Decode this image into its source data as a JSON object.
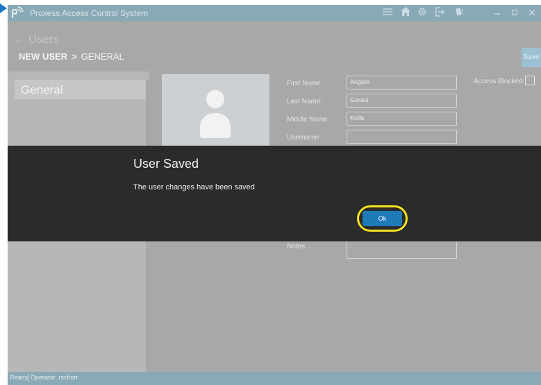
{
  "app": {
    "title": "Proxess Access Control System",
    "brand_color": "#8aa9b6"
  },
  "titlebar_icons": [
    "menu-icon",
    "home-icon",
    "gear-icon",
    "logout-icon",
    "badge-icon",
    "minimize-icon",
    "maximize-icon",
    "close-icon"
  ],
  "header": {
    "back_label": "← Users",
    "breadcrumb": {
      "section": "NEW USER",
      "separator": ">",
      "page": "GENERAL"
    },
    "save_label": "Save"
  },
  "sidebar": {
    "items": [
      {
        "label": "General"
      }
    ]
  },
  "form": {
    "fields": [
      {
        "label": "First Name",
        "value": "Angelo"
      },
      {
        "label": "Last Name:",
        "value": "Geraci"
      },
      {
        "label": "Middle Name:",
        "value": "Knife"
      },
      {
        "label": "Username",
        "value": ""
      }
    ],
    "access_blocked_label": "Access Blocked:",
    "access_blocked_checked": false,
    "notes_label": "Notes:",
    "notes_value": ""
  },
  "modal": {
    "title": "User Saved",
    "message": "The user changes have been saved",
    "ok_label": "Ok",
    "highlight_color": "#f4e51f"
  },
  "status": {
    "ready": "Ready",
    "operator": "Operator: rschorr"
  }
}
